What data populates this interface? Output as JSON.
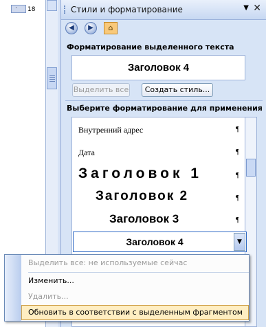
{
  "ruler": {
    "value": "18"
  },
  "pane": {
    "title": "Стили и форматирование",
    "dropdown_icon": "▼",
    "close_icon": "✕",
    "nav": {
      "back": "◀",
      "forward": "▶",
      "home": "⌂"
    },
    "selected_text_section": "Форматирование выделенного текста",
    "current_style": "Заголовок 4",
    "select_all_button": "Выделить все",
    "create_style_button": "Создать стиль...",
    "apply_section": "Выберите форматирование для применения",
    "pilcrow": "¶",
    "styles": [
      {
        "name": "Внутренний адрес"
      },
      {
        "name": "Дата"
      },
      {
        "name": "Заголовок 1"
      },
      {
        "name": "Заголовок 2"
      },
      {
        "name": "Заголовок 3"
      }
    ],
    "selected_style": "Заголовок 4",
    "arrow": "▼"
  },
  "menu": {
    "items": [
      {
        "label": "Выделить все: не используемые сейчас",
        "enabled": false
      },
      {
        "label": "Изменить...",
        "enabled": true
      },
      {
        "label": "Удалить...",
        "enabled": false
      },
      {
        "label": "Обновить в соответствии с выделенным фрагментом",
        "enabled": true,
        "highlighted": true
      }
    ]
  }
}
